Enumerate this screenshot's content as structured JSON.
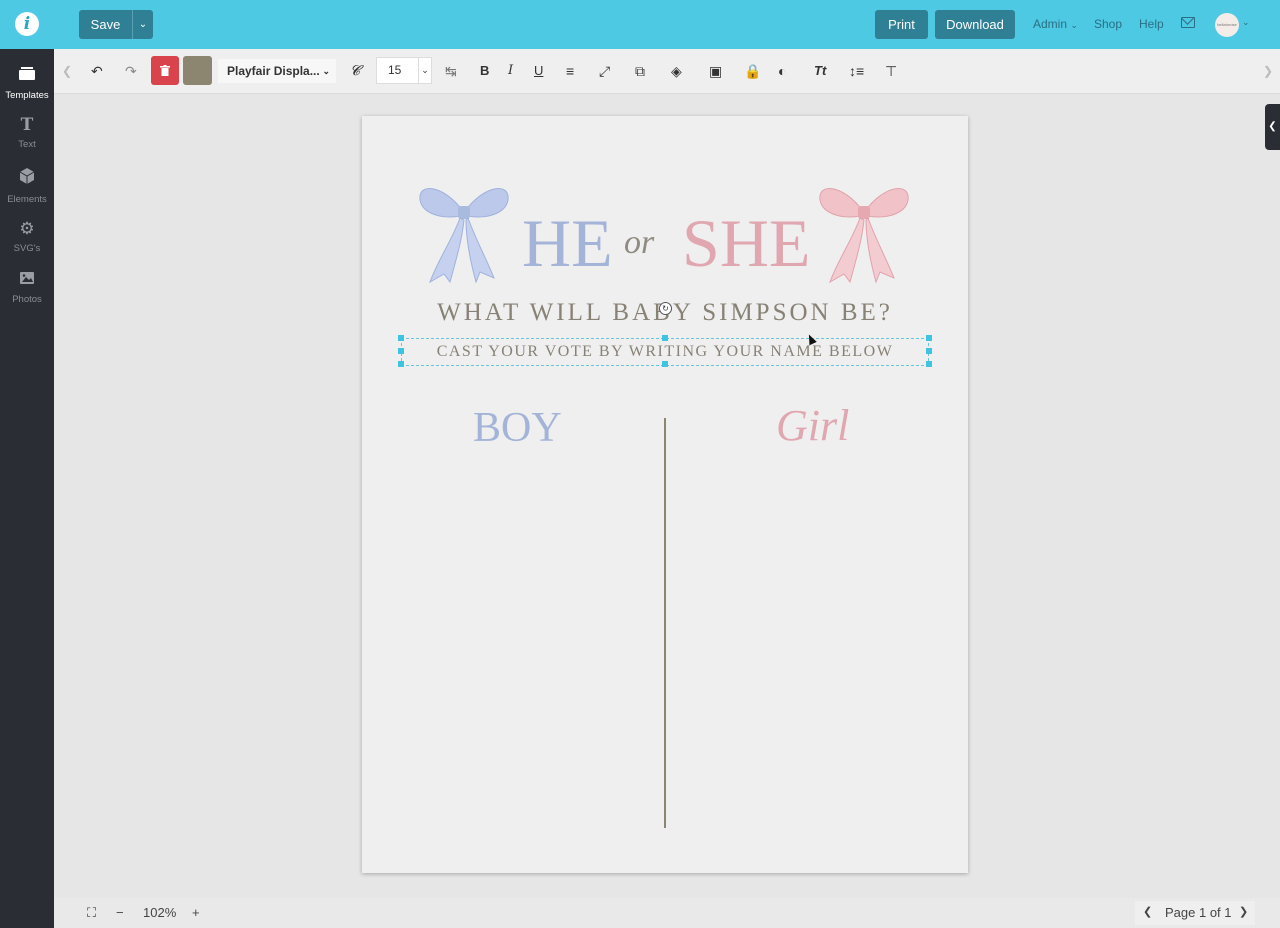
{
  "topbar": {
    "logo_letter": "i",
    "save_label": "Save",
    "print_label": "Print",
    "download_label": "Download",
    "admin_label": "Admin",
    "shop_label": "Shop",
    "help_label": "Help",
    "avatar_text": "bellatorose",
    "colors": {
      "bar": "#4ec9e4",
      "button": "#2f7f95"
    }
  },
  "sidebar": {
    "items": [
      {
        "label": "Templates",
        "icon": "templates-icon"
      },
      {
        "label": "Text",
        "icon": "text-icon"
      },
      {
        "label": "Elements",
        "icon": "elements-icon"
      },
      {
        "label": "SVG's",
        "icon": "svg-gear-icon"
      },
      {
        "label": "Photos",
        "icon": "photos-icon"
      }
    ]
  },
  "toolbar": {
    "font_family": "Playfair Displa...",
    "font_size": "15",
    "text_color": "#8c8670",
    "delete_color": "#d9434b"
  },
  "design": {
    "he": "HE",
    "or": "or",
    "she": "SHE",
    "heading": "WHAT WILL BABY SIMPSON BE?",
    "subheading": "CAST YOUR VOTE BY WRITING YOUR NAME BELOW",
    "boy": "BOY",
    "girl": "Girl",
    "colors": {
      "blue": "#a4b4d8",
      "pink": "#e0a7b0",
      "text": "#888276"
    }
  },
  "bottombar": {
    "zoom": "102%",
    "page_indicator": "Page 1 of 1"
  }
}
